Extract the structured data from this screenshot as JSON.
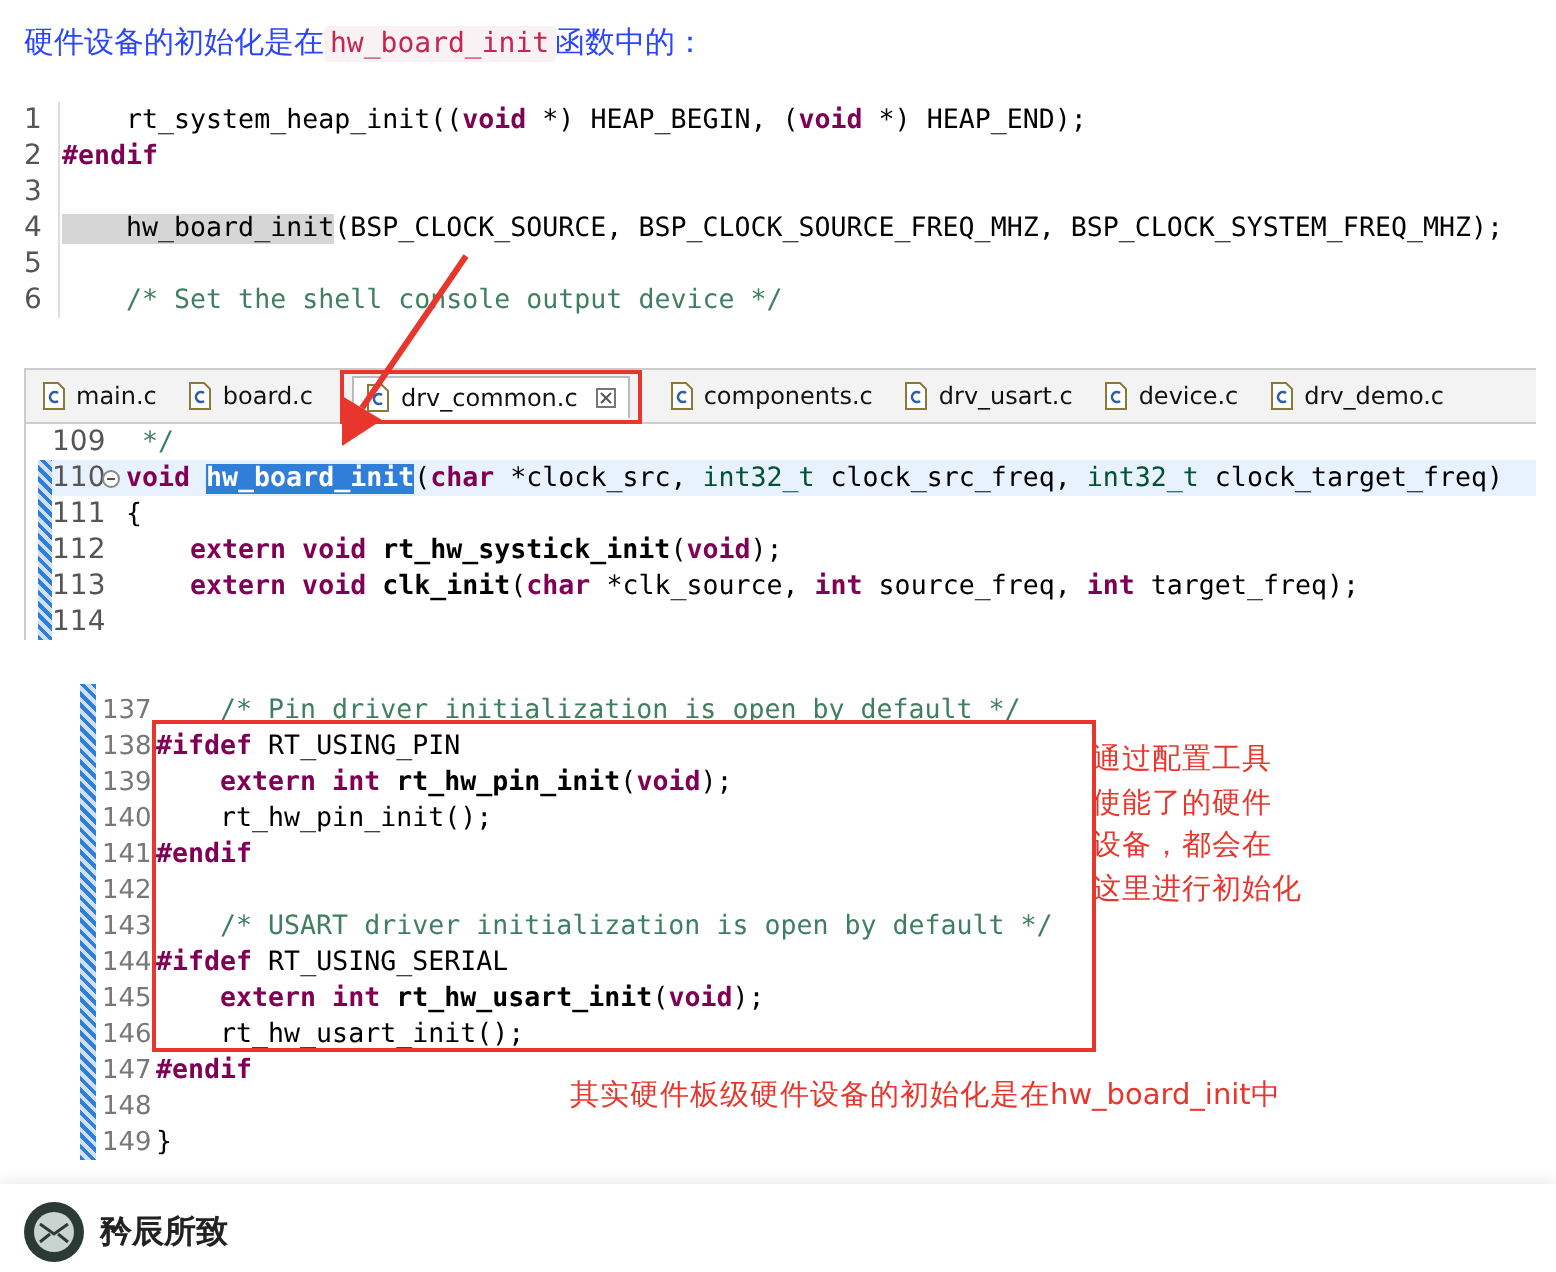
{
  "intro": {
    "before": "硬件设备的初始化是在",
    "code": "hw_board_init",
    "after": "函数中的："
  },
  "snippet_1": {
    "lines": [
      {
        "num": "1",
        "segments": [
          {
            "kind": "plain",
            "text": "    rt_system_heap_init(("
          },
          {
            "kind": "kw",
            "text": "void"
          },
          {
            "kind": "plain",
            "text": " *) HEAP_BEGIN, ("
          },
          {
            "kind": "kw",
            "text": "void"
          },
          {
            "kind": "plain",
            "text": " *) HEAP_END);"
          }
        ]
      },
      {
        "num": "2",
        "segments": [
          {
            "kind": "kw",
            "text": "#endif"
          }
        ]
      },
      {
        "num": "3"
      },
      {
        "num": "4",
        "segments": [
          {
            "kind": "mark",
            "text": "    hw_board_init"
          },
          {
            "kind": "plain",
            "text": "(BSP_CLOCK_SOURCE, BSP_CLOCK_SOURCE_FREQ_MHZ, BSP_CLOCK_SYSTEM_FREQ_MHZ);"
          }
        ]
      },
      {
        "num": "5"
      },
      {
        "num": "6",
        "segments": [
          {
            "kind": "comment",
            "text": "    /* Set the shell console output device */"
          }
        ]
      }
    ]
  },
  "editor": {
    "tabs": [
      {
        "label": "main.c",
        "selected": false,
        "boxed": false
      },
      {
        "label": "board.c",
        "selected": false,
        "boxed": false
      },
      {
        "label": "drv_common.c",
        "selected": true,
        "boxed": true
      },
      {
        "label": "components.c",
        "selected": false,
        "boxed": false
      },
      {
        "label": "drv_usart.c",
        "selected": false,
        "boxed": false
      },
      {
        "label": "device.c",
        "selected": false,
        "boxed": false
      },
      {
        "label": "drv_demo.c",
        "selected": false,
        "boxed": false
      }
    ],
    "lines": [
      {
        "num": "109",
        "current": false,
        "foldable": false,
        "segments": [
          {
            "kind": "comment",
            "text": " */"
          }
        ]
      },
      {
        "num": "110",
        "current": true,
        "foldable": true,
        "segments": [
          {
            "kind": "kw",
            "text": "void "
          },
          {
            "kind": "sel",
            "text": "hw_board_init"
          },
          {
            "kind": "plain",
            "text": "("
          },
          {
            "kind": "kw",
            "text": "char"
          },
          {
            "kind": "plain",
            "text": " *clock_src, "
          },
          {
            "kind": "type",
            "text": "int32_t"
          },
          {
            "kind": "plain",
            "text": " clock_src_freq, "
          },
          {
            "kind": "type",
            "text": "int32_t"
          },
          {
            "kind": "plain",
            "text": " clock_target_freq)"
          }
        ]
      },
      {
        "num": "111",
        "current": false,
        "foldable": false,
        "segments": [
          {
            "kind": "plain",
            "text": "{"
          }
        ]
      },
      {
        "num": "112",
        "current": false,
        "foldable": false,
        "segments": [
          {
            "kind": "kw",
            "text": "    extern void "
          },
          {
            "kind": "fn",
            "text": "rt_hw_systick_init"
          },
          {
            "kind": "plain",
            "text": "("
          },
          {
            "kind": "kw",
            "text": "void"
          },
          {
            "kind": "plain",
            "text": ");"
          }
        ]
      },
      {
        "num": "113",
        "current": false,
        "foldable": false,
        "segments": [
          {
            "kind": "kw",
            "text": "    extern void "
          },
          {
            "kind": "fn",
            "text": "clk_init"
          },
          {
            "kind": "plain",
            "text": "("
          },
          {
            "kind": "kw",
            "text": "char"
          },
          {
            "kind": "plain",
            "text": " *clk_source, "
          },
          {
            "kind": "kw",
            "text": "int"
          },
          {
            "kind": "plain",
            "text": " source_freq, "
          },
          {
            "kind": "kw",
            "text": "int"
          },
          {
            "kind": "plain",
            "text": " target_freq);"
          }
        ]
      },
      {
        "num": "114",
        "current": false,
        "foldable": false
      }
    ]
  },
  "snippet_3": {
    "lines": [
      {
        "num": "137",
        "segments": [
          {
            "kind": "comment",
            "text": "    /* Pin driver initialization is open by default */"
          }
        ]
      },
      {
        "num": "138",
        "segments": [
          {
            "kind": "kw",
            "text": "#ifdef"
          },
          {
            "kind": "plain",
            "text": " RT_USING_PIN"
          }
        ]
      },
      {
        "num": "139",
        "segments": [
          {
            "kind": "kw",
            "text": "    extern int "
          },
          {
            "kind": "fn",
            "text": "rt_hw_pin_init"
          },
          {
            "kind": "plain",
            "text": "("
          },
          {
            "kind": "kw",
            "text": "void"
          },
          {
            "kind": "plain",
            "text": ");"
          }
        ]
      },
      {
        "num": "140",
        "segments": [
          {
            "kind": "plain",
            "text": "    rt_hw_pin_init();"
          }
        ]
      },
      {
        "num": "141",
        "segments": [
          {
            "kind": "kw",
            "text": "#endif"
          }
        ]
      },
      {
        "num": "142"
      },
      {
        "num": "143",
        "segments": [
          {
            "kind": "comment",
            "text": "    /* USART driver initialization is open by default */"
          }
        ]
      },
      {
        "num": "144",
        "segments": [
          {
            "kind": "kw",
            "text": "#ifdef"
          },
          {
            "kind": "plain",
            "text": " RT_USING_SERIAL"
          }
        ]
      },
      {
        "num": "145",
        "segments": [
          {
            "kind": "kw",
            "text": "    extern int "
          },
          {
            "kind": "fn",
            "text": "rt_hw_usart_init"
          },
          {
            "kind": "plain",
            "text": "("
          },
          {
            "kind": "kw",
            "text": "void"
          },
          {
            "kind": "plain",
            "text": ");"
          }
        ]
      },
      {
        "num": "146",
        "segments": [
          {
            "kind": "plain",
            "text": "    rt_hw_usart_init();"
          }
        ]
      },
      {
        "num": "147",
        "segments": [
          {
            "kind": "kw",
            "text": "#endif"
          }
        ]
      },
      {
        "num": "148"
      },
      {
        "num": "149",
        "segments": [
          {
            "kind": "plain",
            "text": "}"
          }
        ]
      }
    ],
    "side_note": [
      "通过配置工具",
      "使能了的硬件",
      "设备，都会在",
      "这里进行初始化"
    ],
    "bottom_note": "其实硬件板级硬件设备的初始化是在hw_board_init中"
  },
  "author": {
    "name": "矜辰所致"
  }
}
